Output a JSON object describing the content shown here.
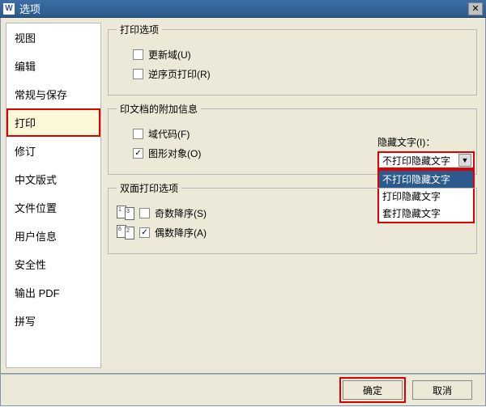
{
  "titlebar": {
    "icon_letter": "W",
    "title": "选项"
  },
  "sidebar": {
    "items": [
      {
        "label": "视图"
      },
      {
        "label": "编辑"
      },
      {
        "label": "常规与保存"
      },
      {
        "label": "打印",
        "selected": true
      },
      {
        "label": "修订"
      },
      {
        "label": "中文版式"
      },
      {
        "label": "文件位置"
      },
      {
        "label": "用户信息"
      },
      {
        "label": "安全性"
      },
      {
        "label": "输出 PDF"
      },
      {
        "label": "拼写"
      }
    ]
  },
  "groups": {
    "print_options": {
      "legend": "打印选项",
      "update_field": "更新域(U)",
      "reverse_order": "逆序页打印(R)"
    },
    "attach_info": {
      "legend": "印文档的附加信息",
      "field_code": "域代码(F)",
      "graphic_obj": "图形对象(O)",
      "hidden_text_label": "隐藏文字(I)：",
      "combo_value": "不打印隐藏文字",
      "dropdown": [
        "不打印隐藏文字",
        "打印隐藏文字",
        "套打隐藏文字"
      ]
    },
    "duplex": {
      "legend": "双面打印选项",
      "odd_desc": "奇数降序(S)",
      "even_desc": "偶数降序(A)"
    }
  },
  "footer": {
    "ok": "确定",
    "cancel": "取消"
  }
}
